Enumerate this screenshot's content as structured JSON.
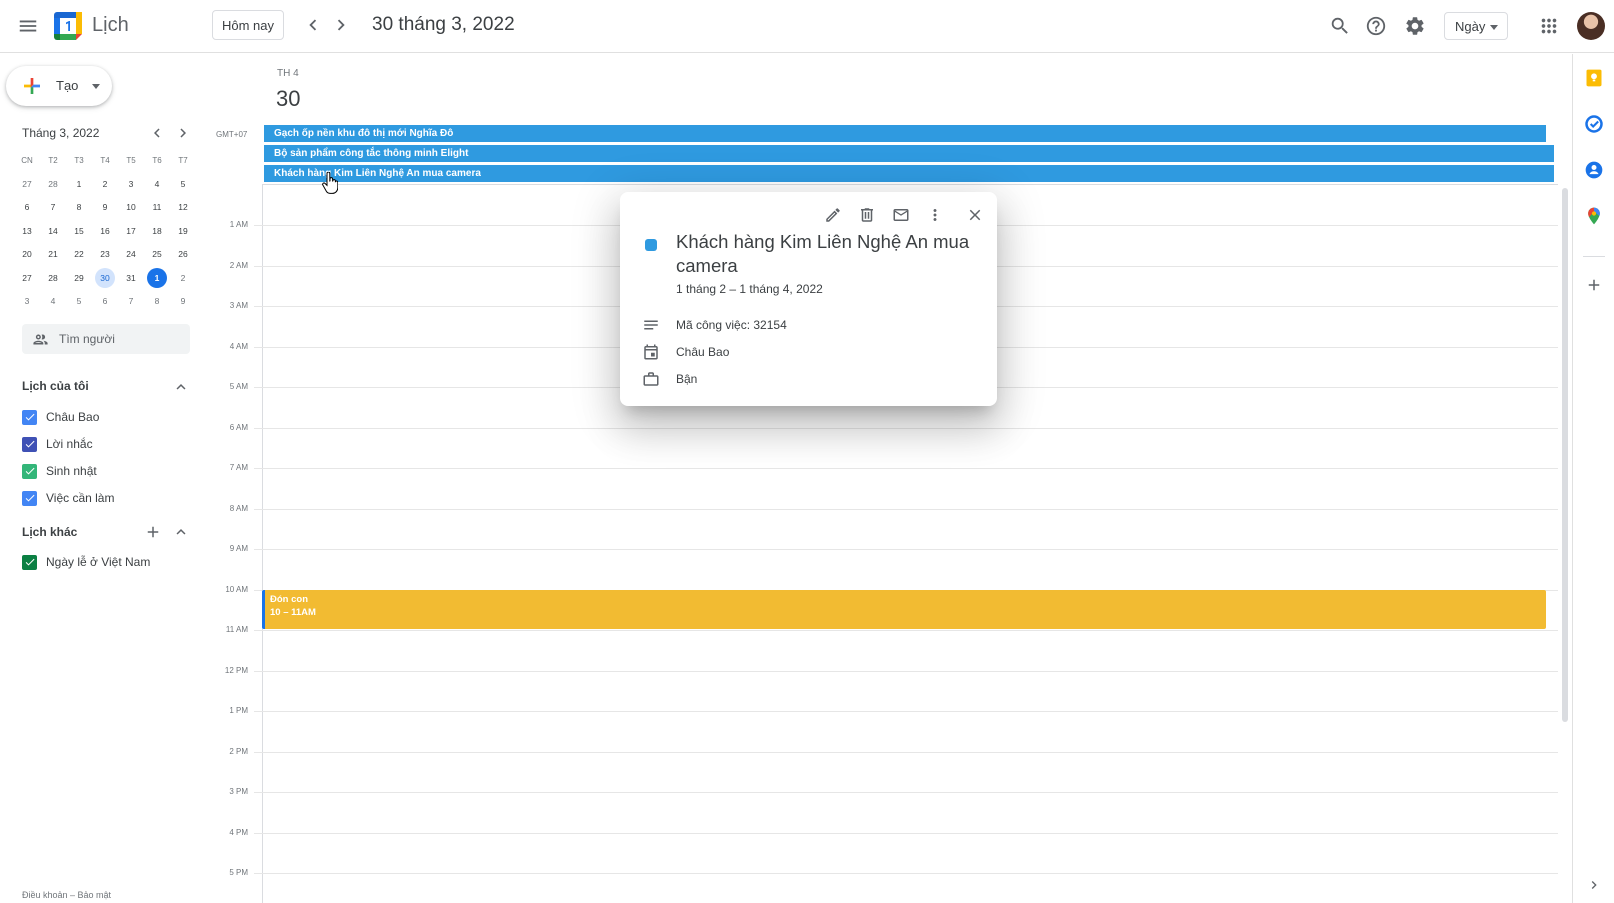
{
  "header": {
    "app_title": "Lịch",
    "today_button": "Hôm nay",
    "date_title": "30 tháng 3, 2022",
    "view_selector": "Ngày"
  },
  "sidebar": {
    "create_label": "Tạo",
    "mini_calendar": {
      "title": "Tháng 3, 2022",
      "weekdays": [
        "CN",
        "T2",
        "T3",
        "T4",
        "T5",
        "T6",
        "T7"
      ],
      "weeks": [
        [
          "27",
          "28",
          "1",
          "2",
          "3",
          "4",
          "5"
        ],
        [
          "6",
          "7",
          "8",
          "9",
          "10",
          "11",
          "12"
        ],
        [
          "13",
          "14",
          "15",
          "16",
          "17",
          "18",
          "19"
        ],
        [
          "20",
          "21",
          "22",
          "23",
          "24",
          "25",
          "26"
        ],
        [
          "27",
          "28",
          "29",
          "30",
          "31",
          "1",
          "2"
        ],
        [
          "3",
          "4",
          "5",
          "6",
          "7",
          "8",
          "9"
        ]
      ]
    },
    "search_people_placeholder": "Tìm người",
    "my_calendars": {
      "title": "Lịch của tôi",
      "items": [
        {
          "label": "Châu Bao",
          "color": "#4285f4"
        },
        {
          "label": "Lời nhắc",
          "color": "#3f51b5"
        },
        {
          "label": "Sinh nhật",
          "color": "#33b679"
        },
        {
          "label": "Việc cần làm",
          "color": "#4285f4"
        }
      ]
    },
    "other_calendars": {
      "title": "Lịch khác",
      "items": [
        {
          "label": "Ngày lễ ở Việt Nam",
          "color": "#0b8043"
        }
      ]
    },
    "footer": "Điều khoản – Bảo mật"
  },
  "day_view": {
    "day_abbr": "TH 4",
    "day_number": "30",
    "timezone": "GMT+07",
    "all_day_events": [
      "Gạch ốp nền khu đô thị mới Nghĩa Đô",
      "Bộ sản phẩm công tắc thông minh Elight",
      "Khách hàng Kim Liên Nghệ An mua camera"
    ],
    "hours": [
      "1 AM",
      "2 AM",
      "3 AM",
      "4 AM",
      "5 AM",
      "6 AM",
      "7 AM",
      "8 AM",
      "9 AM",
      "10 AM",
      "11 AM",
      "12 PM",
      "1 PM",
      "2 PM",
      "3 PM",
      "4 PM",
      "5 PM"
    ],
    "timed_event": {
      "title": "Đón con",
      "time": "10 – 11AM",
      "color": "#f2bb32"
    }
  },
  "event_popup": {
    "title": "Khách hàng Kim Liên Nghệ An mua camera",
    "date_range": "1 tháng 2 – 1 tháng 4, 2022",
    "description": "Mã công việc: 32154",
    "calendar": "Châu Bao",
    "availability": "Bận",
    "color": "#2f9ae0"
  },
  "colors": {
    "accent": "#1a73e8",
    "all_day_event": "#2f9ae0",
    "selected_day": "#d2e3fc"
  }
}
